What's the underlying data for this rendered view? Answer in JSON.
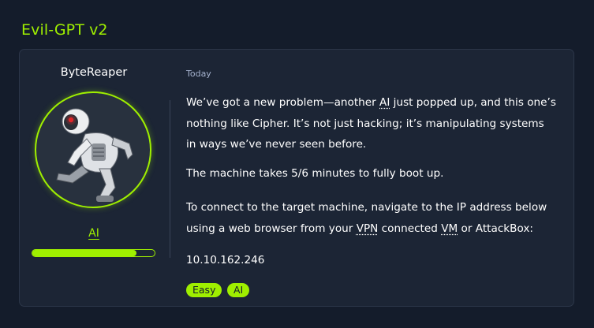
{
  "page": {
    "title": "Evil-GPT v2"
  },
  "author": {
    "name": "ByteReaper",
    "role": "AI",
    "progress": 0.85
  },
  "message": {
    "timestamp": "Today",
    "p1": {
      "t1": "We’ve got a new problem—another ",
      "link_ai": "AI",
      "t2": " just popped up, and this one’s nothing like Cipher. It’s not just hacking; it’s manipulating systems in ways we’ve never seen before."
    },
    "p2": "The machine takes 5/6 minutes to fully boot up.",
    "p3": {
      "t1": "To connect to the target machine, navigate to the IP address below using a web browser from your ",
      "link_vpn": "VPN",
      "t2": " connected ",
      "link_vm": "VM",
      "t3": " or AttackBox:"
    },
    "ip": "10.10.162.246"
  },
  "tags": [
    "Easy",
    "AI"
  ],
  "colors": {
    "accent": "#9fef00",
    "background": "#141c2b",
    "card": "#1c2535"
  }
}
